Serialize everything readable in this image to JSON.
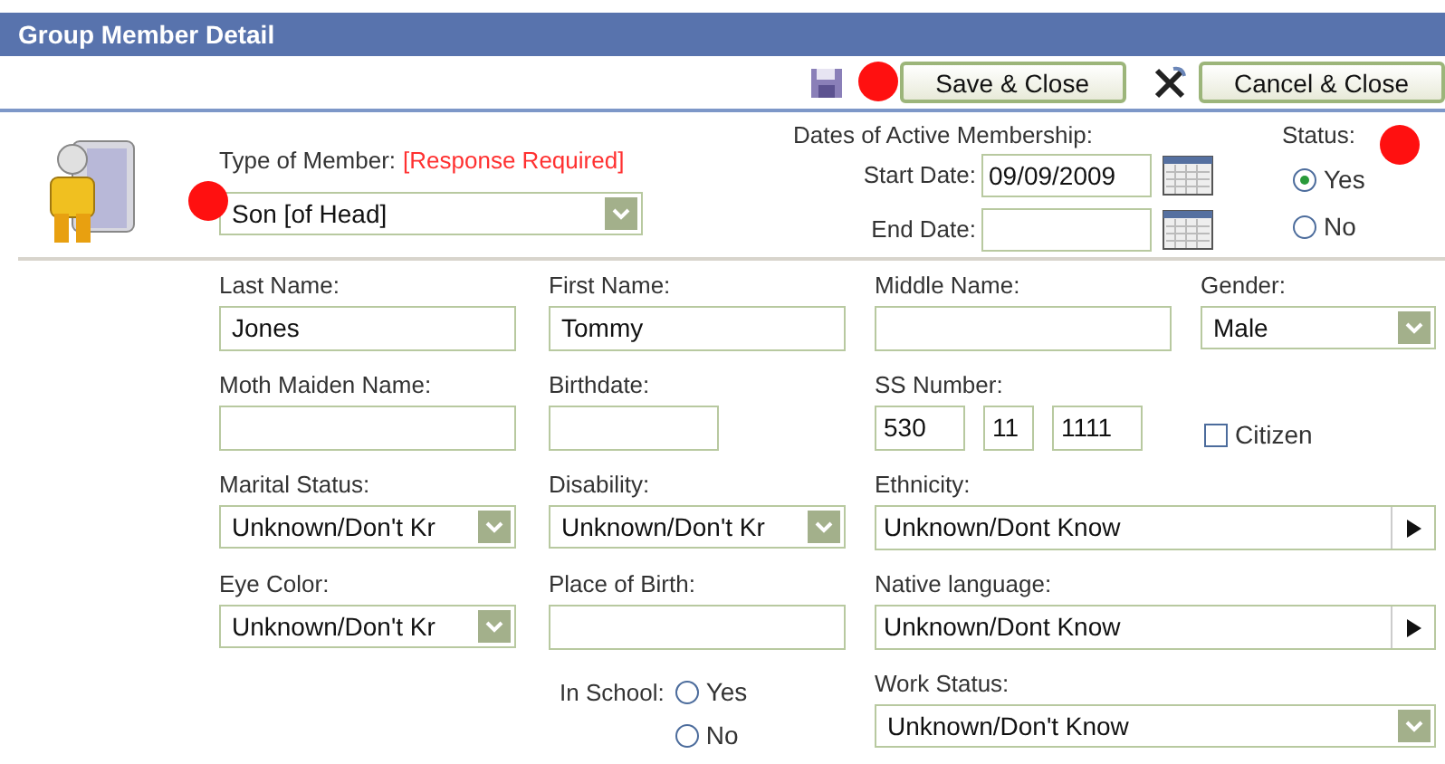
{
  "window": {
    "title": "Group Member Detail"
  },
  "toolbar": {
    "buttons": [
      {
        "label": "Save & Close",
        "kind": "save"
      },
      {
        "label": "Cancel & Close",
        "kind": "cancel"
      }
    ]
  },
  "member_type": {
    "label": "Type of Member:",
    "required_note": "[Response Required]",
    "value": "Son [of Head]"
  },
  "membership_dates": {
    "label": "Dates of Active Membership:",
    "start": {
      "label": "Start Date:",
      "value": "09/09/2009"
    },
    "end": {
      "label": "End Date:"
    }
  },
  "status": {
    "label": "Status:",
    "options": [
      {
        "label": "Yes",
        "selected": true
      },
      {
        "label": "No",
        "selected": false
      }
    ]
  },
  "form_rows": [
    [
      {
        "kind": "text",
        "label": "Last Name:",
        "value": "Jones"
      },
      {
        "kind": "text",
        "label": "First Name:",
        "value": "Tommy"
      },
      {
        "kind": "text",
        "label": "Middle Name:"
      },
      {
        "kind": "select",
        "label": "Gender:",
        "value": "Male"
      }
    ],
    [
      {
        "kind": "text",
        "label": "Moth Maiden Name:"
      },
      {
        "kind": "short",
        "label": "Birthdate:"
      },
      {
        "kind": "ssn",
        "label": "SS Number:",
        "parts": [
          "530",
          "11",
          "1111"
        ]
      },
      {
        "kind": "checkbox",
        "label": "Citizen",
        "checked": false
      }
    ],
    [
      {
        "kind": "select",
        "label": "Marital Status:",
        "value": "Unknown/Don't Kr"
      },
      {
        "kind": "select",
        "label": "Disability:",
        "value": "Unknown/Don't Kr"
      },
      {
        "kind": "picker",
        "label": "Ethnicity:",
        "value": "Unknown/Dont Know"
      }
    ],
    [
      {
        "kind": "select",
        "label": "Eye Color:",
        "value": "Unknown/Don't Kr"
      },
      {
        "kind": "text",
        "label": "Place of Birth:"
      },
      {
        "kind": "picker",
        "label": "Native language:",
        "value": "Unknown/Dont Know"
      }
    ],
    [
      {
        "kind": "radio",
        "label": "In School:",
        "options": [
          {
            "label": "Yes",
            "selected": false
          },
          {
            "label": "No",
            "selected": false
          }
        ]
      },
      {
        "kind": "wide_select",
        "label": "Work Status:",
        "value": "Unknown/Don't Know"
      }
    ]
  ]
}
